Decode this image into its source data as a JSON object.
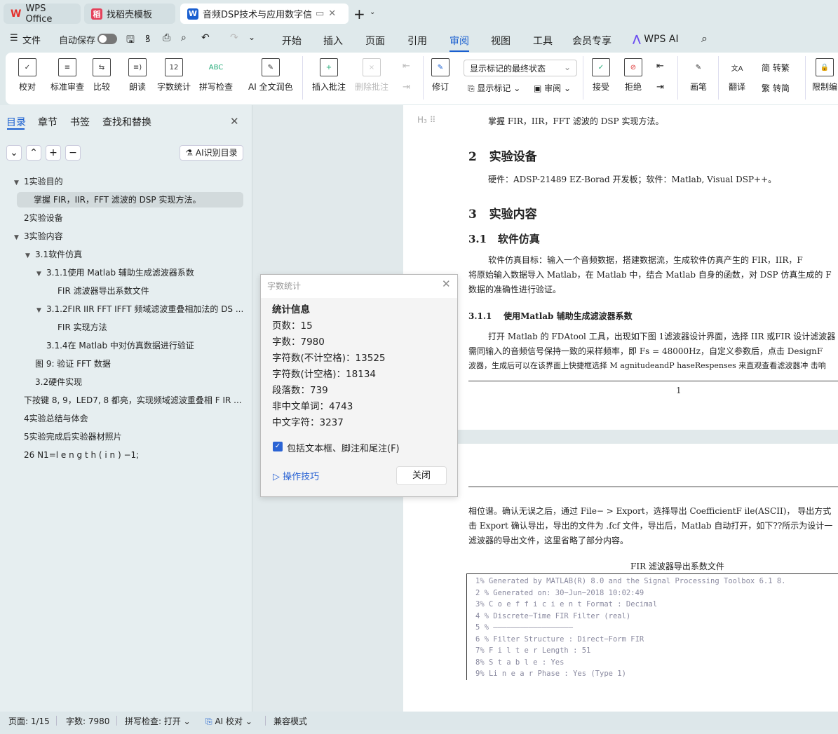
{
  "tabs": [
    {
      "label": "WPS Office",
      "icon": "wps-logo-icon"
    },
    {
      "label": "找稻壳模板",
      "icon": "docer-icon"
    },
    {
      "label": "音频DSP技术与应用数字信号",
      "icon": "word-doc-icon"
    }
  ],
  "menu": {
    "file": "文件",
    "autosave": "自动保存",
    "autosave_on": false,
    "items": [
      "开始",
      "插入",
      "页面",
      "引用",
      "审阅",
      "视图",
      "工具",
      "会员专享"
    ],
    "active": "审阅",
    "wps_ai": "WPS AI"
  },
  "ribbon": {
    "proof": "校对",
    "std_review": "标准审查",
    "compare": "比较",
    "read": "朗读",
    "word_count": "字数统计",
    "spell": "拼写检查",
    "ai_polish": "AI 全文润色",
    "insert_comment": "插入批注",
    "delete_comment": "删除批注",
    "revise": "修订",
    "markup_select": "显示标记的最终状态",
    "show_markup": "显示标记",
    "review": "审阅",
    "accept": "接受",
    "reject": "拒绝",
    "pen": "画笔",
    "translate": "翻译",
    "to_trad": "转繁",
    "to_simp": "转简",
    "restrict": "限制编",
    "wc_icon_text": "12",
    "spell_icon_text": "ABC",
    "trad_char": "简",
    "simp_char": "繁"
  },
  "sidebar": {
    "tabs": [
      "目录",
      "章节",
      "书签",
      "查找和替换"
    ],
    "active": "目录",
    "ai_toc": "AI识别目录",
    "toc": [
      {
        "label": "1实验目的",
        "level": 0,
        "expanded": true
      },
      {
        "label": "掌握 FIR，IIR，FFT 滤波的 DSP 实现方法。",
        "level": 1,
        "selected": true
      },
      {
        "label": "2实验设备",
        "level": 0
      },
      {
        "label": "3实验内容",
        "level": 0,
        "expanded": true
      },
      {
        "label": "3.1软件仿真",
        "level": 1,
        "expanded": true
      },
      {
        "label": "3.1.1使用 Matlab 辅助生成滤波器系数",
        "level": 2,
        "expanded": true
      },
      {
        "label": "FIR 滤波器导出系数文件",
        "level": 3
      },
      {
        "label": "3.1.2FIR IIR FFT IFFT 频域滤波重叠相加法的 DS ...",
        "level": 2,
        "expanded": true
      },
      {
        "label": "FIR 实现方法",
        "level": 3
      },
      {
        "label": "3.1.4在 Matlab 中对仿真数据进行验证",
        "level": 2
      },
      {
        "label": "图 9: 验证 FFT 数据",
        "level": 1
      },
      {
        "label": "3.2硬件实现",
        "level": 1
      },
      {
        "label": "下按键 8, 9，LED7, 8 都亮，实现频域滤波重叠相 F IR ...",
        "level": 0
      },
      {
        "label": "4实验总结与体会",
        "level": 0
      },
      {
        "label": "5实验完成后实验器材照片",
        "level": 0
      },
      {
        "label": "26  N1=l e n g t h ( i n ) −1;",
        "level": 0
      }
    ]
  },
  "doc": {
    "p1": "掌握 FIR，IIR，FFT 滤波的 DSP 实现方法。",
    "h2_num": "2",
    "h2": "实验设备",
    "p2": "硬件：ADSP-21489 EZ-Borad 开发板；软件：Matlab, Visual DSP++。",
    "h3_num": "3",
    "h3": "实验内容",
    "h31_num": "3.1",
    "h31": "软件仿真",
    "p3a": "软件仿真目标：输入一个音频数据，搭建数据流，生成软件仿真产生的 FIR，IIR，F",
    "p3b": "将原始输入数据导入 Matlab，在 Matlab 中，结合 Matlab 自身的函数，对 DSP 仿真生成的 F",
    "p3c": "数据的准确性进行验证。",
    "h311_num": "3.1.1",
    "h311": "使用Matlab 辅助生成滤波器系数",
    "p4a": "打开 Matlab 的 FDAtool 工具，出现如下图 1滤波器设计界面，选择 IIR 或FIR 设计滤波器",
    "p4b": "需同输入的音频信号保持一致的采样频率，即 Fs = 48000Hz，自定义参数后，点击 DesignF",
    "p4c": "波器，生成后可以在该界面上快捷框选择 M agnitudeandP haseRespenses  来直观查看滤波器冲 击响",
    "page_num": "1",
    "p5a": "相位谱。确认无误之后，通过 File− > Export，选择导出 CoefficientF ile(ASCII)， 导出方式",
    "p5b": "击 Export 确认导出，导出的文件为 .fcf 文件，导出后，Matlab 自动打开，如下??所示为设计一",
    "p5c": "滤波器的导出文件，这里省略了部分内容。",
    "caption": "FIR 滤波器导出系数文件",
    "code": [
      "1% Generated  by MATLAB(R) 8.0  and the  Signal Processing  Toolbox 6.1 8.",
      "2 % Generated  on:  30−Jun−2018  10:02:49",
      "3% C o e f f i c i e n t Format : Decimal",
      "4 % Discrete−Time  FIR  Filter  (real)",
      "5  % ——————————————————",
      "6 % Filter  Structure    : Direct−Form FIR",
      "7% F i l t e r Length         : 51",
      "8% S t a b l e                    : Yes",
      "9% Li n e a r Phase           : Yes (Type 1)"
    ]
  },
  "dialog": {
    "title": "字数统计",
    "section": "统计信息",
    "stats": [
      {
        "label": "页数：",
        "value": "15"
      },
      {
        "label": "字数：",
        "value": "7980"
      },
      {
        "label": "字符数(不计空格)：",
        "value": "13525"
      },
      {
        "label": "字符数(计空格)：",
        "value": "18134"
      },
      {
        "label": "段落数：",
        "value": "739"
      },
      {
        "label": "非中文单词：",
        "value": "4743"
      },
      {
        "label": "中文字符：",
        "value": "3237"
      }
    ],
    "include_label": "包括文本框、脚注和尾注(F)",
    "include_checked": true,
    "tips": "操作技巧",
    "close": "关闭"
  },
  "status": {
    "page": "页面: 1/15",
    "words": "字数: 7980",
    "spell": "拼写检查: 打开",
    "ai_proof": "AI 校对",
    "compat": "兼容模式"
  },
  "colors": {
    "accent": "#1a5fd0",
    "wps_red": "#e4302b"
  }
}
